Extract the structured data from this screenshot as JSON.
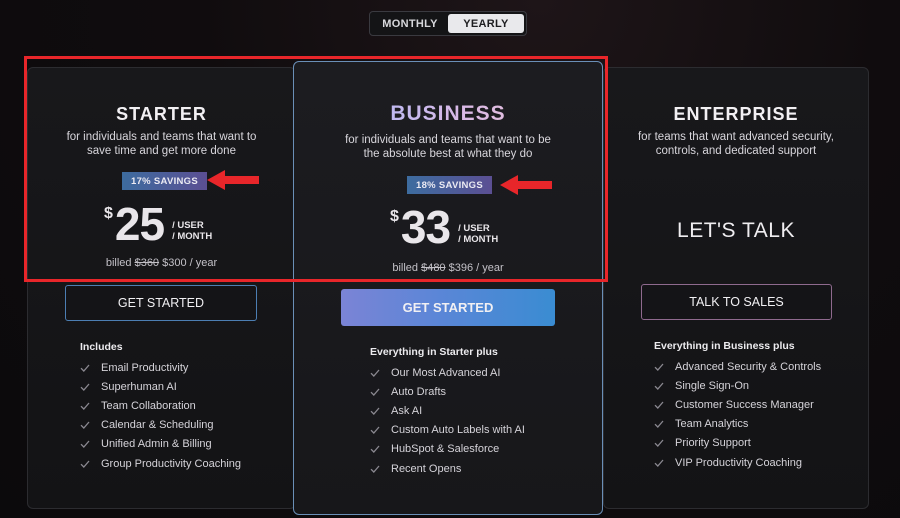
{
  "toggle": {
    "monthly": "MONTHLY",
    "yearly": "YEARLY",
    "selected": "yearly"
  },
  "plans": {
    "starter": {
      "name": "STARTER",
      "desc_line1": "for individuals and teams that want to",
      "desc_line2": "save time and get more done",
      "savings": "17% SAVINGS",
      "currency": "$",
      "price": "25",
      "per_line1": "/ USER",
      "per_line2": "/ MONTH",
      "billed_prefix": "billed",
      "billed_old": "$360",
      "billed_new": "$300 / year",
      "cta": "GET STARTED",
      "features_title": "Includes",
      "features": [
        "Email Productivity",
        "Superhuman AI",
        "Team Collaboration",
        "Calendar & Scheduling",
        "Unified Admin & Billing",
        "Group Productivity Coaching"
      ]
    },
    "business": {
      "name": "BUSINESS",
      "desc_line1": "for individuals and teams that want to be",
      "desc_line2": "the absolute best at what they do",
      "savings": "18% SAVINGS",
      "currency": "$",
      "price": "33",
      "per_line1": "/ USER",
      "per_line2": "/ MONTH",
      "billed_prefix": "billed",
      "billed_old": "$480",
      "billed_new": "$396 / year",
      "cta": "GET STARTED",
      "features_title": "Everything in Starter plus",
      "features": [
        "Our Most Advanced AI",
        "Auto Drafts",
        "Ask AI",
        "Custom Auto Labels with AI",
        "HubSpot & Salesforce",
        "Recent Opens"
      ]
    },
    "enterprise": {
      "name": "ENTERPRISE",
      "desc_line1": "for teams that want advanced security,",
      "desc_line2": "controls, and dedicated support",
      "headline": "LET'S TALK",
      "cta": "TALK TO SALES",
      "features_title": "Everything in Business plus",
      "features": [
        "Advanced Security & Controls",
        "Single Sign-On",
        "Customer Success Manager",
        "Team Analytics",
        "Priority Support",
        "VIP Productivity Coaching"
      ]
    }
  },
  "colors": {
    "annotation": "#e8262a",
    "business_border": "#6a8fb7",
    "savings_gradient_start": "#3d6c9f",
    "savings_gradient_end": "#5b4f93"
  },
  "icons": {
    "feature_bullet": "checkmark-icon",
    "annotation": "arrow-left-icon"
  }
}
